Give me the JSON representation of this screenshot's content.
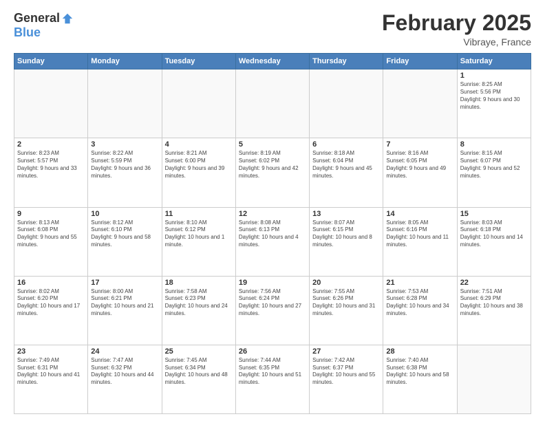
{
  "header": {
    "logo_general": "General",
    "logo_blue": "Blue",
    "title": "February 2025",
    "location": "Vibraye, France"
  },
  "calendar": {
    "days_of_week": [
      "Sunday",
      "Monday",
      "Tuesday",
      "Wednesday",
      "Thursday",
      "Friday",
      "Saturday"
    ],
    "weeks": [
      [
        {
          "day": "",
          "info": ""
        },
        {
          "day": "",
          "info": ""
        },
        {
          "day": "",
          "info": ""
        },
        {
          "day": "",
          "info": ""
        },
        {
          "day": "",
          "info": ""
        },
        {
          "day": "",
          "info": ""
        },
        {
          "day": "1",
          "info": "Sunrise: 8:25 AM\nSunset: 5:56 PM\nDaylight: 9 hours and 30 minutes."
        }
      ],
      [
        {
          "day": "2",
          "info": "Sunrise: 8:23 AM\nSunset: 5:57 PM\nDaylight: 9 hours and 33 minutes."
        },
        {
          "day": "3",
          "info": "Sunrise: 8:22 AM\nSunset: 5:59 PM\nDaylight: 9 hours and 36 minutes."
        },
        {
          "day": "4",
          "info": "Sunrise: 8:21 AM\nSunset: 6:00 PM\nDaylight: 9 hours and 39 minutes."
        },
        {
          "day": "5",
          "info": "Sunrise: 8:19 AM\nSunset: 6:02 PM\nDaylight: 9 hours and 42 minutes."
        },
        {
          "day": "6",
          "info": "Sunrise: 8:18 AM\nSunset: 6:04 PM\nDaylight: 9 hours and 45 minutes."
        },
        {
          "day": "7",
          "info": "Sunrise: 8:16 AM\nSunset: 6:05 PM\nDaylight: 9 hours and 49 minutes."
        },
        {
          "day": "8",
          "info": "Sunrise: 8:15 AM\nSunset: 6:07 PM\nDaylight: 9 hours and 52 minutes."
        }
      ],
      [
        {
          "day": "9",
          "info": "Sunrise: 8:13 AM\nSunset: 6:08 PM\nDaylight: 9 hours and 55 minutes."
        },
        {
          "day": "10",
          "info": "Sunrise: 8:12 AM\nSunset: 6:10 PM\nDaylight: 9 hours and 58 minutes."
        },
        {
          "day": "11",
          "info": "Sunrise: 8:10 AM\nSunset: 6:12 PM\nDaylight: 10 hours and 1 minute."
        },
        {
          "day": "12",
          "info": "Sunrise: 8:08 AM\nSunset: 6:13 PM\nDaylight: 10 hours and 4 minutes."
        },
        {
          "day": "13",
          "info": "Sunrise: 8:07 AM\nSunset: 6:15 PM\nDaylight: 10 hours and 8 minutes."
        },
        {
          "day": "14",
          "info": "Sunrise: 8:05 AM\nSunset: 6:16 PM\nDaylight: 10 hours and 11 minutes."
        },
        {
          "day": "15",
          "info": "Sunrise: 8:03 AM\nSunset: 6:18 PM\nDaylight: 10 hours and 14 minutes."
        }
      ],
      [
        {
          "day": "16",
          "info": "Sunrise: 8:02 AM\nSunset: 6:20 PM\nDaylight: 10 hours and 17 minutes."
        },
        {
          "day": "17",
          "info": "Sunrise: 8:00 AM\nSunset: 6:21 PM\nDaylight: 10 hours and 21 minutes."
        },
        {
          "day": "18",
          "info": "Sunrise: 7:58 AM\nSunset: 6:23 PM\nDaylight: 10 hours and 24 minutes."
        },
        {
          "day": "19",
          "info": "Sunrise: 7:56 AM\nSunset: 6:24 PM\nDaylight: 10 hours and 27 minutes."
        },
        {
          "day": "20",
          "info": "Sunrise: 7:55 AM\nSunset: 6:26 PM\nDaylight: 10 hours and 31 minutes."
        },
        {
          "day": "21",
          "info": "Sunrise: 7:53 AM\nSunset: 6:28 PM\nDaylight: 10 hours and 34 minutes."
        },
        {
          "day": "22",
          "info": "Sunrise: 7:51 AM\nSunset: 6:29 PM\nDaylight: 10 hours and 38 minutes."
        }
      ],
      [
        {
          "day": "23",
          "info": "Sunrise: 7:49 AM\nSunset: 6:31 PM\nDaylight: 10 hours and 41 minutes."
        },
        {
          "day": "24",
          "info": "Sunrise: 7:47 AM\nSunset: 6:32 PM\nDaylight: 10 hours and 44 minutes."
        },
        {
          "day": "25",
          "info": "Sunrise: 7:45 AM\nSunset: 6:34 PM\nDaylight: 10 hours and 48 minutes."
        },
        {
          "day": "26",
          "info": "Sunrise: 7:44 AM\nSunset: 6:35 PM\nDaylight: 10 hours and 51 minutes."
        },
        {
          "day": "27",
          "info": "Sunrise: 7:42 AM\nSunset: 6:37 PM\nDaylight: 10 hours and 55 minutes."
        },
        {
          "day": "28",
          "info": "Sunrise: 7:40 AM\nSunset: 6:38 PM\nDaylight: 10 hours and 58 minutes."
        },
        {
          "day": "",
          "info": ""
        }
      ]
    ]
  }
}
